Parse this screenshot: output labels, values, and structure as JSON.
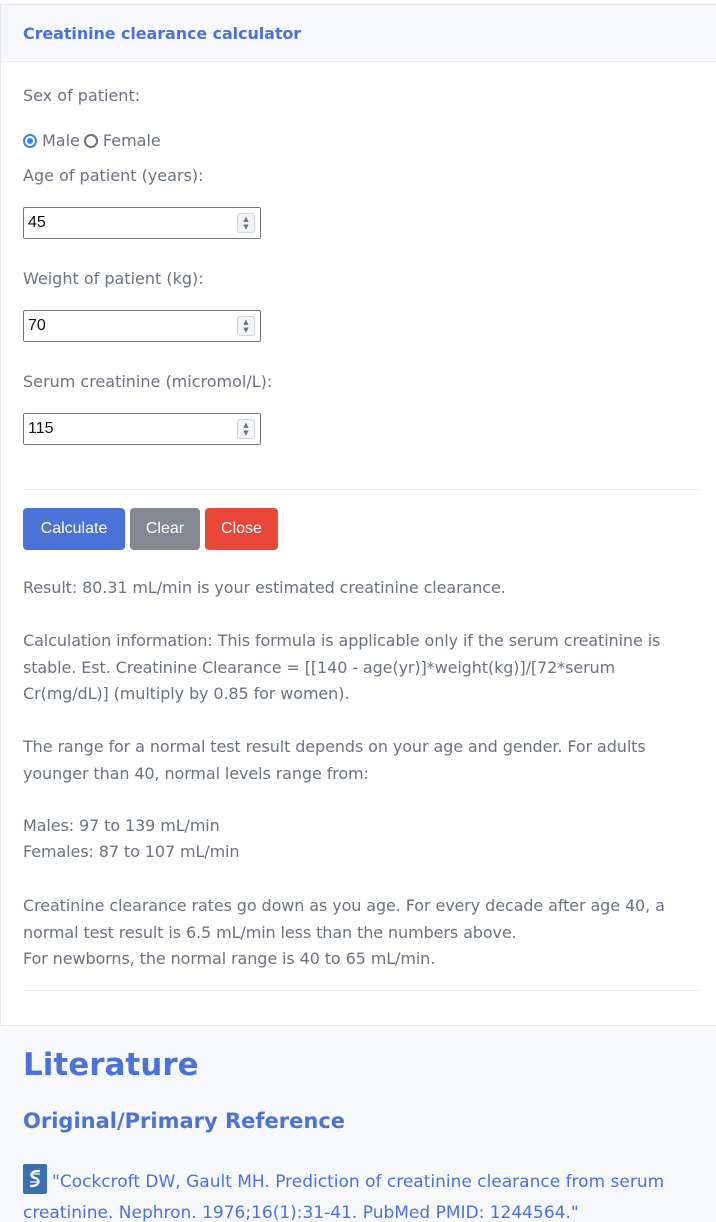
{
  "card": {
    "title": "Creatinine clearance calculator"
  },
  "form": {
    "sex_label": "Sex of patient:",
    "sex_options": {
      "male": "Male",
      "female": "Female"
    },
    "sex_selected": "Male",
    "age_label": "Age of patient (years):",
    "age_value": "45",
    "weight_label": "Weight of patient (kg):",
    "weight_value": "70",
    "creatinine_label": "Serum creatinine (micromol/L):",
    "creatinine_value": "115"
  },
  "buttons": {
    "calculate": "Calculate",
    "clear": "Clear",
    "close": "Close"
  },
  "result": {
    "line": "Result: 80.31 mL/min is your estimated creatinine clearance.",
    "calc_info": "Calculation information: This formula is applicable only if the serum creatinine is stable. Est. Creatinine Clearance = [[140 - age(yr)]*weight(kg)]/[72*serum Cr(mg/dL)] (multiply by 0.85 for women).",
    "range_intro": "The range for a normal test result depends on your age and gender. For adults younger than 40, normal levels range from:",
    "males": "Males: 97 to 139 mL/min",
    "females": "Females: 87 to 107 mL/min",
    "decline": "Creatinine clearance rates go down as you age. For every decade after age 40, a normal test result is 6.5 mL/min less than the numbers above.",
    "newborns": "For newborns, the normal range is 40 to 65 mL/min."
  },
  "literature": {
    "heading": "Literature",
    "subheading": "Original/Primary Reference",
    "reference": "\"Cockcroft DW, Gault MH. Prediction of creatinine clearance from serum creatinine. Nephron. 1976;16(1):31-41. PubMed PMID: 1244564.\"",
    "icon": "pubmed-icon"
  },
  "colors": {
    "accent": "#4a72d8",
    "clear": "#838892",
    "close": "#e8473a",
    "radio": "#3b82f6"
  }
}
